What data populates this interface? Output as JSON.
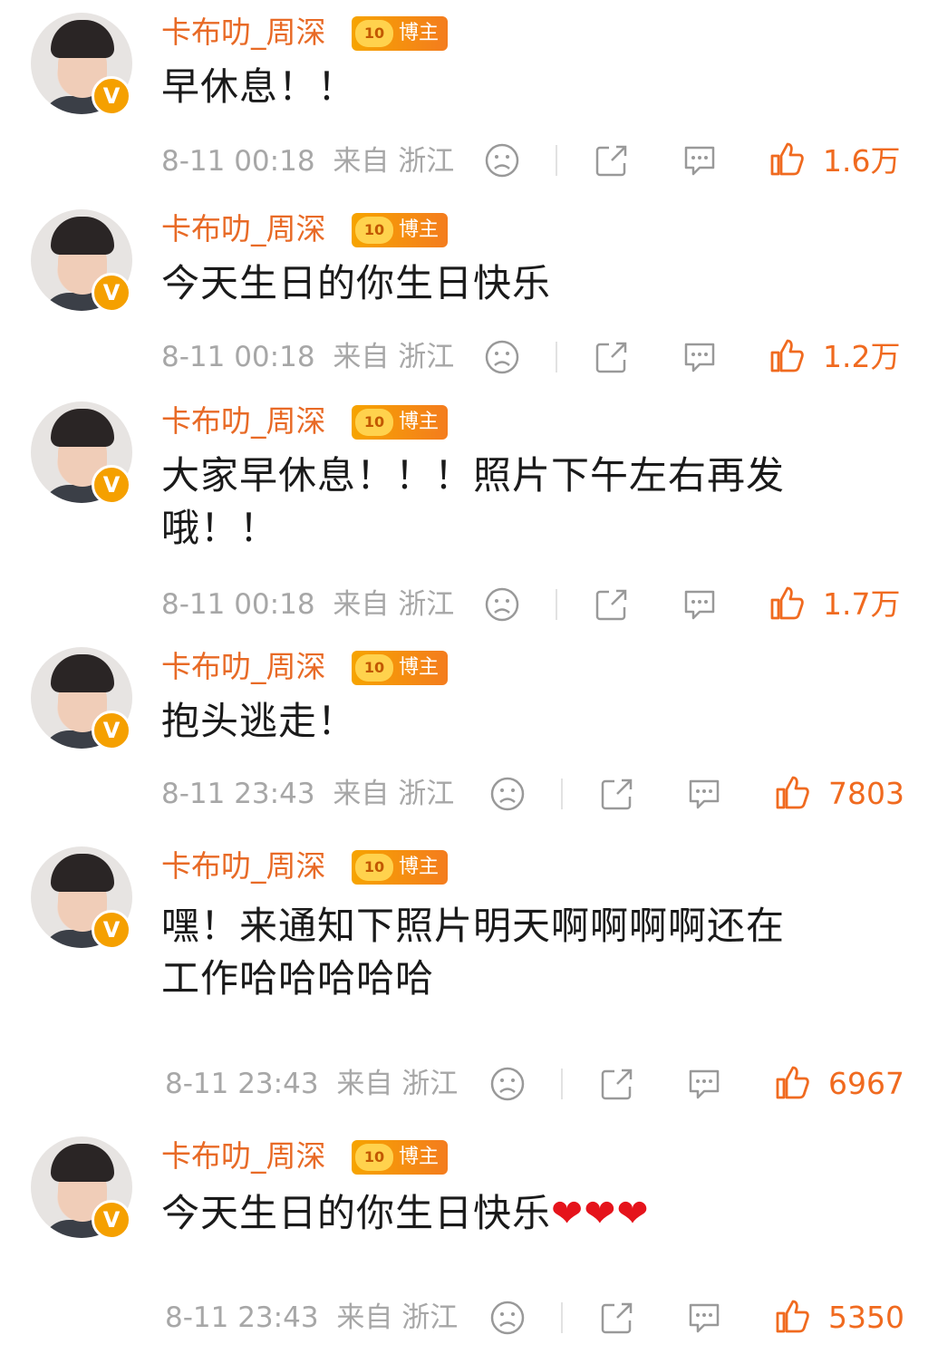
{
  "posts": [
    {
      "author": "卡布叻_周深",
      "badge_level": "10",
      "badge_label": "博主",
      "text": "早休息！！",
      "date": "8-11 00:18",
      "source": "来自 浙江",
      "likes": "1.6万"
    },
    {
      "author": "卡布叻_周深",
      "badge_level": "10",
      "badge_label": "博主",
      "text": "今天生日的你生日快乐",
      "date": "8-11 00:18",
      "source": "来自 浙江",
      "likes": "1.2万"
    },
    {
      "author": "卡布叻_周深",
      "badge_level": "10",
      "badge_label": "博主",
      "text_lines": [
        "大家早休息！！！照片下午左右再发",
        "哦！！"
      ],
      "date": "8-11 00:18",
      "source": "来自 浙江",
      "likes": "1.7万"
    },
    {
      "author": "卡布叻_周深",
      "badge_level": "10",
      "badge_label": "博主",
      "text": "抱头逃走！",
      "date": "8-11 23:43",
      "source": "来自 浙江",
      "likes": "7803"
    },
    {
      "author": "卡布叻_周深",
      "badge_level": "10",
      "badge_label": "博主",
      "text_lines": [
        "嘿！来通知下照片明天啊啊啊啊还在",
        "工作哈哈哈哈哈"
      ],
      "date": "8-11 23:43",
      "source": "来自 浙江",
      "likes": "6967"
    },
    {
      "author": "卡布叻_周深",
      "badge_level": "10",
      "badge_label": "博主",
      "text": "今天生日的你生日快乐",
      "text_hearts": "❤❤❤",
      "date": "8-11 23:43",
      "source": "来自 浙江",
      "likes": "5350"
    }
  ],
  "icons": {
    "verified": "verified-v-icon",
    "dislike": "sad-face-icon",
    "share": "share-icon",
    "comment": "comment-icon",
    "like": "thumbs-up-icon"
  },
  "colors": {
    "author": "#e86a26",
    "likes": "#f06a1f",
    "meta": "#a7a7a7",
    "badge": "#f6a400",
    "heart": "#e5131b"
  }
}
